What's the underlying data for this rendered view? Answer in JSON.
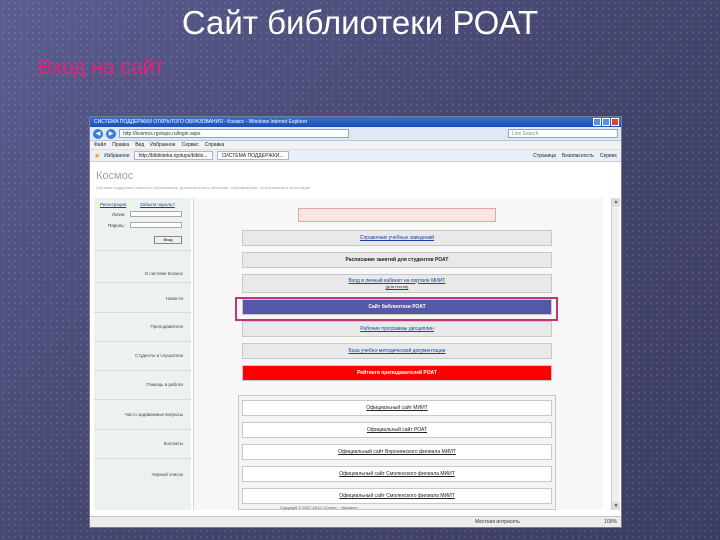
{
  "slide": {
    "title": "Сайт библиотеки РОАТ",
    "subtitle": "Вход на сайт"
  },
  "browser": {
    "window_title": "СИСТЕМА ПОДДЕРЖКИ ОТКРЫТОГО ОБРАЗОВАНИЯ - Космос - Windows Internet Explorer",
    "url": "http://kosmos.rgotups.ru/login.aspx",
    "search_placeholder": "Live Search",
    "menu": [
      "Файл",
      "Правка",
      "Вид",
      "Избранное",
      "Сервис",
      "Справка"
    ],
    "favorites_label": "Избранное",
    "tabs": [
      "http://biblioteka.rgotups/biblio...",
      "СИСТЕМА ПОДДЕРЖКИ..."
    ],
    "commands": [
      "Страница",
      "Безопасность",
      "Сервис"
    ],
    "status_zone": "Местная интрасеть",
    "zoom": "100%"
  },
  "site": {
    "logo": "Космос",
    "tagline": "Система поддержки открытого образования, дистанционного обучения, сертификации, тестирования и аттестации",
    "login": {
      "register_link": "Регистрация",
      "forgot_link": "Забыли пароль?",
      "login_label": "Логин:",
      "password_label": "Пароль:",
      "submit_label": "Вход"
    },
    "side_menu": [
      "О системе Космос",
      "Новости",
      "Преподаватели",
      "Студенты и слушатели",
      "Помощь в работе",
      "Часто задаваемые вопросы",
      "Контакты",
      "Черный список"
    ],
    "menu_buttons": [
      {
        "label": "Справочник учебных заведений",
        "sub": ""
      },
      {
        "label": "Расписание занятий для студентов РОАТ",
        "sub": ""
      },
      {
        "label": "Вход в личный кабинет на портале МИИТ",
        "sub": "(для тестов)"
      },
      {
        "label": "Сайт библиотеки РОАТ",
        "sub": ""
      },
      {
        "label": "Рабочие программы дисциплин",
        "sub": ""
      },
      {
        "label": "База учебно-методической документации",
        "sub": ""
      },
      {
        "label": "Рейтинги преподавателей РОАТ",
        "sub": ""
      }
    ],
    "links": [
      "Официальный сайт МИИТ",
      "Официальный сайт РОАТ",
      "Официальный сайт Воронежского филиала МИИТ",
      "Официальный сайт Смоленского филиала МИИТ",
      "Официальный сайт Смоленского филиала МИИТ"
    ],
    "footer": "Copyright © 2007-2012 «Союз» - «Космос»"
  }
}
